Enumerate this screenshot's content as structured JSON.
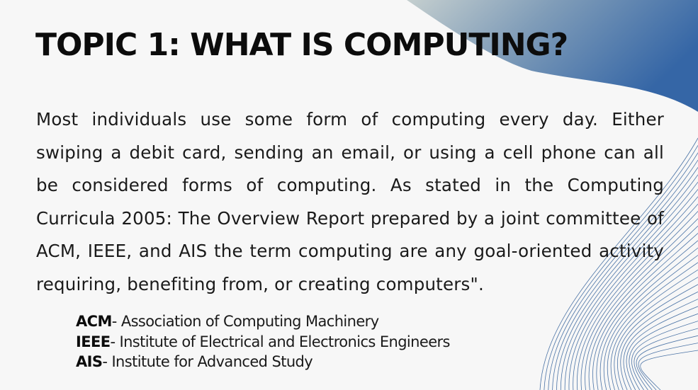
{
  "slide": {
    "title": "TOPIC 1: WHAT IS COMPUTING?",
    "body": "Most individuals use some form of computing every day. Either swiping a debit card, sending an email, or using a cell phone can all be considered forms of computing. As stated in the Computing Curricula 2005: The Overview Report prepared by a joint committee of ACM, IEEE, and AIS the term computing are any goal-oriented activity requiring, benefiting from, or creating computers\".",
    "definitions": [
      {
        "abbr": "ACM",
        "text": "- Association of Computing Machinery"
      },
      {
        "abbr": "IEEE",
        "text": "- Institute of Electrical and Electronics Engineers"
      },
      {
        "abbr": "AIS",
        "text": "- Institute for Advanced Study"
      }
    ]
  },
  "colors": {
    "background": "#f7f7f7",
    "accent_dark": "#3566a6",
    "accent_light": "#b9c5c9",
    "wave_lines": "#2e5d98",
    "text": "#1a1a1a"
  },
  "icons": [
    "corner-gradient-shape",
    "wave-lines-decoration"
  ]
}
